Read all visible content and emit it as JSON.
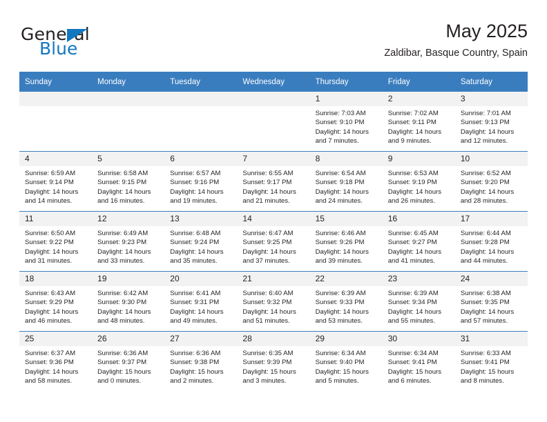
{
  "logo": {
    "word_top": "General",
    "word_bottom": "Blue",
    "triangle_icon": "blue-triangle-icon",
    "accent_color": "#1277bf"
  },
  "header": {
    "title": "May 2025",
    "subtitle": "Zaldibar, Basque Country, Spain"
  },
  "calendar": {
    "header_color": "#3a7dbf",
    "daynum_band_color": "#f2f2f2",
    "weekday_headers": [
      "Sunday",
      "Monday",
      "Tuesday",
      "Wednesday",
      "Thursday",
      "Friday",
      "Saturday"
    ],
    "weeks": [
      [
        {
          "day": "",
          "empty": true,
          "sunrise": "",
          "sunset": "",
          "daylight1": "",
          "daylight2": ""
        },
        {
          "day": "",
          "empty": true,
          "sunrise": "",
          "sunset": "",
          "daylight1": "",
          "daylight2": ""
        },
        {
          "day": "",
          "empty": true,
          "sunrise": "",
          "sunset": "",
          "daylight1": "",
          "daylight2": ""
        },
        {
          "day": "",
          "empty": true,
          "sunrise": "",
          "sunset": "",
          "daylight1": "",
          "daylight2": ""
        },
        {
          "day": "1",
          "sunrise": "Sunrise: 7:03 AM",
          "sunset": "Sunset: 9:10 PM",
          "daylight1": "Daylight: 14 hours",
          "daylight2": "and 7 minutes."
        },
        {
          "day": "2",
          "sunrise": "Sunrise: 7:02 AM",
          "sunset": "Sunset: 9:11 PM",
          "daylight1": "Daylight: 14 hours",
          "daylight2": "and 9 minutes."
        },
        {
          "day": "3",
          "sunrise": "Sunrise: 7:01 AM",
          "sunset": "Sunset: 9:13 PM",
          "daylight1": "Daylight: 14 hours",
          "daylight2": "and 12 minutes."
        }
      ],
      [
        {
          "day": "4",
          "sunrise": "Sunrise: 6:59 AM",
          "sunset": "Sunset: 9:14 PM",
          "daylight1": "Daylight: 14 hours",
          "daylight2": "and 14 minutes."
        },
        {
          "day": "5",
          "sunrise": "Sunrise: 6:58 AM",
          "sunset": "Sunset: 9:15 PM",
          "daylight1": "Daylight: 14 hours",
          "daylight2": "and 16 minutes."
        },
        {
          "day": "6",
          "sunrise": "Sunrise: 6:57 AM",
          "sunset": "Sunset: 9:16 PM",
          "daylight1": "Daylight: 14 hours",
          "daylight2": "and 19 minutes."
        },
        {
          "day": "7",
          "sunrise": "Sunrise: 6:55 AM",
          "sunset": "Sunset: 9:17 PM",
          "daylight1": "Daylight: 14 hours",
          "daylight2": "and 21 minutes."
        },
        {
          "day": "8",
          "sunrise": "Sunrise: 6:54 AM",
          "sunset": "Sunset: 9:18 PM",
          "daylight1": "Daylight: 14 hours",
          "daylight2": "and 24 minutes."
        },
        {
          "day": "9",
          "sunrise": "Sunrise: 6:53 AM",
          "sunset": "Sunset: 9:19 PM",
          "daylight1": "Daylight: 14 hours",
          "daylight2": "and 26 minutes."
        },
        {
          "day": "10",
          "sunrise": "Sunrise: 6:52 AM",
          "sunset": "Sunset: 9:20 PM",
          "daylight1": "Daylight: 14 hours",
          "daylight2": "and 28 minutes."
        }
      ],
      [
        {
          "day": "11",
          "sunrise": "Sunrise: 6:50 AM",
          "sunset": "Sunset: 9:22 PM",
          "daylight1": "Daylight: 14 hours",
          "daylight2": "and 31 minutes."
        },
        {
          "day": "12",
          "sunrise": "Sunrise: 6:49 AM",
          "sunset": "Sunset: 9:23 PM",
          "daylight1": "Daylight: 14 hours",
          "daylight2": "and 33 minutes."
        },
        {
          "day": "13",
          "sunrise": "Sunrise: 6:48 AM",
          "sunset": "Sunset: 9:24 PM",
          "daylight1": "Daylight: 14 hours",
          "daylight2": "and 35 minutes."
        },
        {
          "day": "14",
          "sunrise": "Sunrise: 6:47 AM",
          "sunset": "Sunset: 9:25 PM",
          "daylight1": "Daylight: 14 hours",
          "daylight2": "and 37 minutes."
        },
        {
          "day": "15",
          "sunrise": "Sunrise: 6:46 AM",
          "sunset": "Sunset: 9:26 PM",
          "daylight1": "Daylight: 14 hours",
          "daylight2": "and 39 minutes."
        },
        {
          "day": "16",
          "sunrise": "Sunrise: 6:45 AM",
          "sunset": "Sunset: 9:27 PM",
          "daylight1": "Daylight: 14 hours",
          "daylight2": "and 41 minutes."
        },
        {
          "day": "17",
          "sunrise": "Sunrise: 6:44 AM",
          "sunset": "Sunset: 9:28 PM",
          "daylight1": "Daylight: 14 hours",
          "daylight2": "and 44 minutes."
        }
      ],
      [
        {
          "day": "18",
          "sunrise": "Sunrise: 6:43 AM",
          "sunset": "Sunset: 9:29 PM",
          "daylight1": "Daylight: 14 hours",
          "daylight2": "and 46 minutes."
        },
        {
          "day": "19",
          "sunrise": "Sunrise: 6:42 AM",
          "sunset": "Sunset: 9:30 PM",
          "daylight1": "Daylight: 14 hours",
          "daylight2": "and 48 minutes."
        },
        {
          "day": "20",
          "sunrise": "Sunrise: 6:41 AM",
          "sunset": "Sunset: 9:31 PM",
          "daylight1": "Daylight: 14 hours",
          "daylight2": "and 49 minutes."
        },
        {
          "day": "21",
          "sunrise": "Sunrise: 6:40 AM",
          "sunset": "Sunset: 9:32 PM",
          "daylight1": "Daylight: 14 hours",
          "daylight2": "and 51 minutes."
        },
        {
          "day": "22",
          "sunrise": "Sunrise: 6:39 AM",
          "sunset": "Sunset: 9:33 PM",
          "daylight1": "Daylight: 14 hours",
          "daylight2": "and 53 minutes."
        },
        {
          "day": "23",
          "sunrise": "Sunrise: 6:39 AM",
          "sunset": "Sunset: 9:34 PM",
          "daylight1": "Daylight: 14 hours",
          "daylight2": "and 55 minutes."
        },
        {
          "day": "24",
          "sunrise": "Sunrise: 6:38 AM",
          "sunset": "Sunset: 9:35 PM",
          "daylight1": "Daylight: 14 hours",
          "daylight2": "and 57 minutes."
        }
      ],
      [
        {
          "day": "25",
          "sunrise": "Sunrise: 6:37 AM",
          "sunset": "Sunset: 9:36 PM",
          "daylight1": "Daylight: 14 hours",
          "daylight2": "and 58 minutes."
        },
        {
          "day": "26",
          "sunrise": "Sunrise: 6:36 AM",
          "sunset": "Sunset: 9:37 PM",
          "daylight1": "Daylight: 15 hours",
          "daylight2": "and 0 minutes."
        },
        {
          "day": "27",
          "sunrise": "Sunrise: 6:36 AM",
          "sunset": "Sunset: 9:38 PM",
          "daylight1": "Daylight: 15 hours",
          "daylight2": "and 2 minutes."
        },
        {
          "day": "28",
          "sunrise": "Sunrise: 6:35 AM",
          "sunset": "Sunset: 9:39 PM",
          "daylight1": "Daylight: 15 hours",
          "daylight2": "and 3 minutes."
        },
        {
          "day": "29",
          "sunrise": "Sunrise: 6:34 AM",
          "sunset": "Sunset: 9:40 PM",
          "daylight1": "Daylight: 15 hours",
          "daylight2": "and 5 minutes."
        },
        {
          "day": "30",
          "sunrise": "Sunrise: 6:34 AM",
          "sunset": "Sunset: 9:41 PM",
          "daylight1": "Daylight: 15 hours",
          "daylight2": "and 6 minutes."
        },
        {
          "day": "31",
          "sunrise": "Sunrise: 6:33 AM",
          "sunset": "Sunset: 9:41 PM",
          "daylight1": "Daylight: 15 hours",
          "daylight2": "and 8 minutes."
        }
      ]
    ]
  }
}
